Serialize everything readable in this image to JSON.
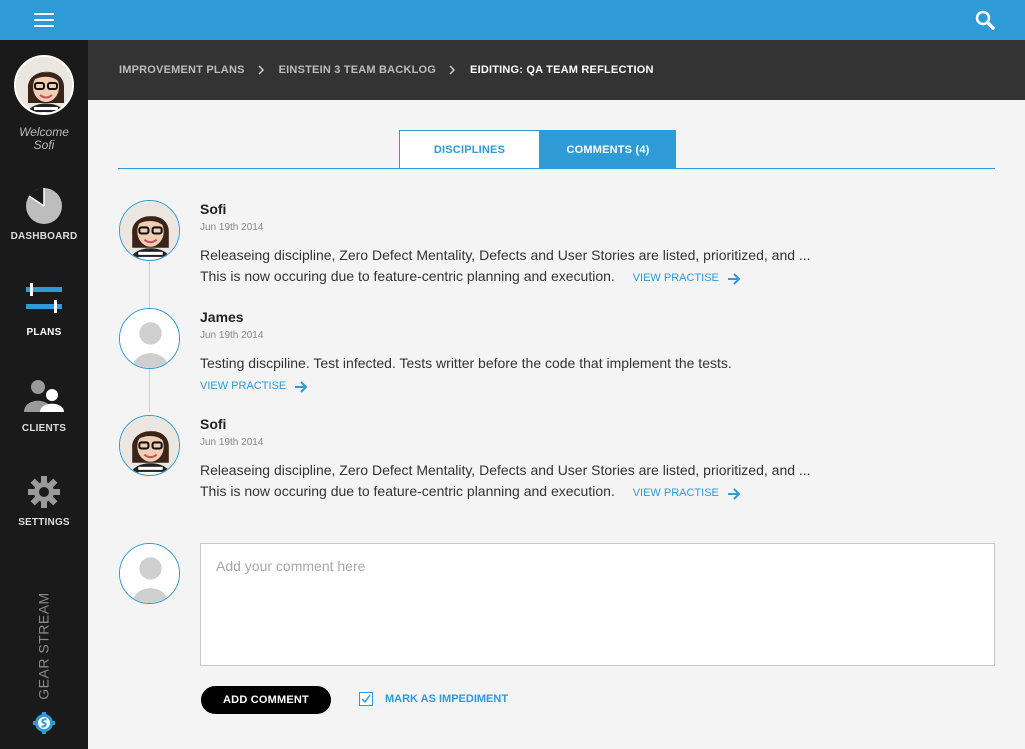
{
  "sidebar": {
    "welcome_line1": "Welcome",
    "welcome_line2": "Sofi",
    "items": [
      {
        "label": "DASHBOARD",
        "icon": "pie-chart-icon"
      },
      {
        "label": "PLANS",
        "icon": "sliders-icon"
      },
      {
        "label": "CLIENTS",
        "icon": "users-icon"
      },
      {
        "label": "SETTINGS",
        "icon": "gear-icon"
      }
    ],
    "brand": "GEAR STREAM"
  },
  "breadcrumb": {
    "items": [
      "IMPROVEMENT PLANS",
      "EINSTEIN 3 TEAM BACKLOG"
    ],
    "current": "EIDITING: QA TEAM REFLECTION"
  },
  "tabs": [
    {
      "label": "DISCIPLINES",
      "active": false
    },
    {
      "label": "COMMENTS (4)",
      "active": true
    }
  ],
  "comments": [
    {
      "author": "Sofi",
      "date": "Jun 19th 2014",
      "line1": "Releaseing discipline, Zero Defect Mentality, Defects and User Stories are listed, prioritized, and ...",
      "line2": "This is now occuring due to feature-centric planning and execution.",
      "link": "VIEW PRACTISE"
    },
    {
      "author": "James",
      "date": "Jun 19th 2014",
      "line1": "Testing discpiline. Test infected. Tests writter before the code that implement the tests.",
      "link": "VIEW PRACTISE"
    },
    {
      "author": "Sofi",
      "date": "Jun 19th 2014",
      "line1": "Releaseing discipline, Zero Defect Mentality, Defects and User Stories are listed, prioritized, and ...",
      "line2": "This is now occuring due to feature-centric planning and execution.",
      "link": "VIEW PRACTISE"
    }
  ],
  "compose": {
    "placeholder": "Add your comment here",
    "value": "",
    "submit_label": "ADD COMMENT",
    "impediment_label": "MARK AS IMPEDIMENT",
    "impediment_checked": true
  },
  "colors": {
    "accent": "#2e9bd6",
    "sidebar": "#1a1a1a",
    "breadcrumb_bg": "#333333",
    "content_bg": "#f4f4f4"
  }
}
